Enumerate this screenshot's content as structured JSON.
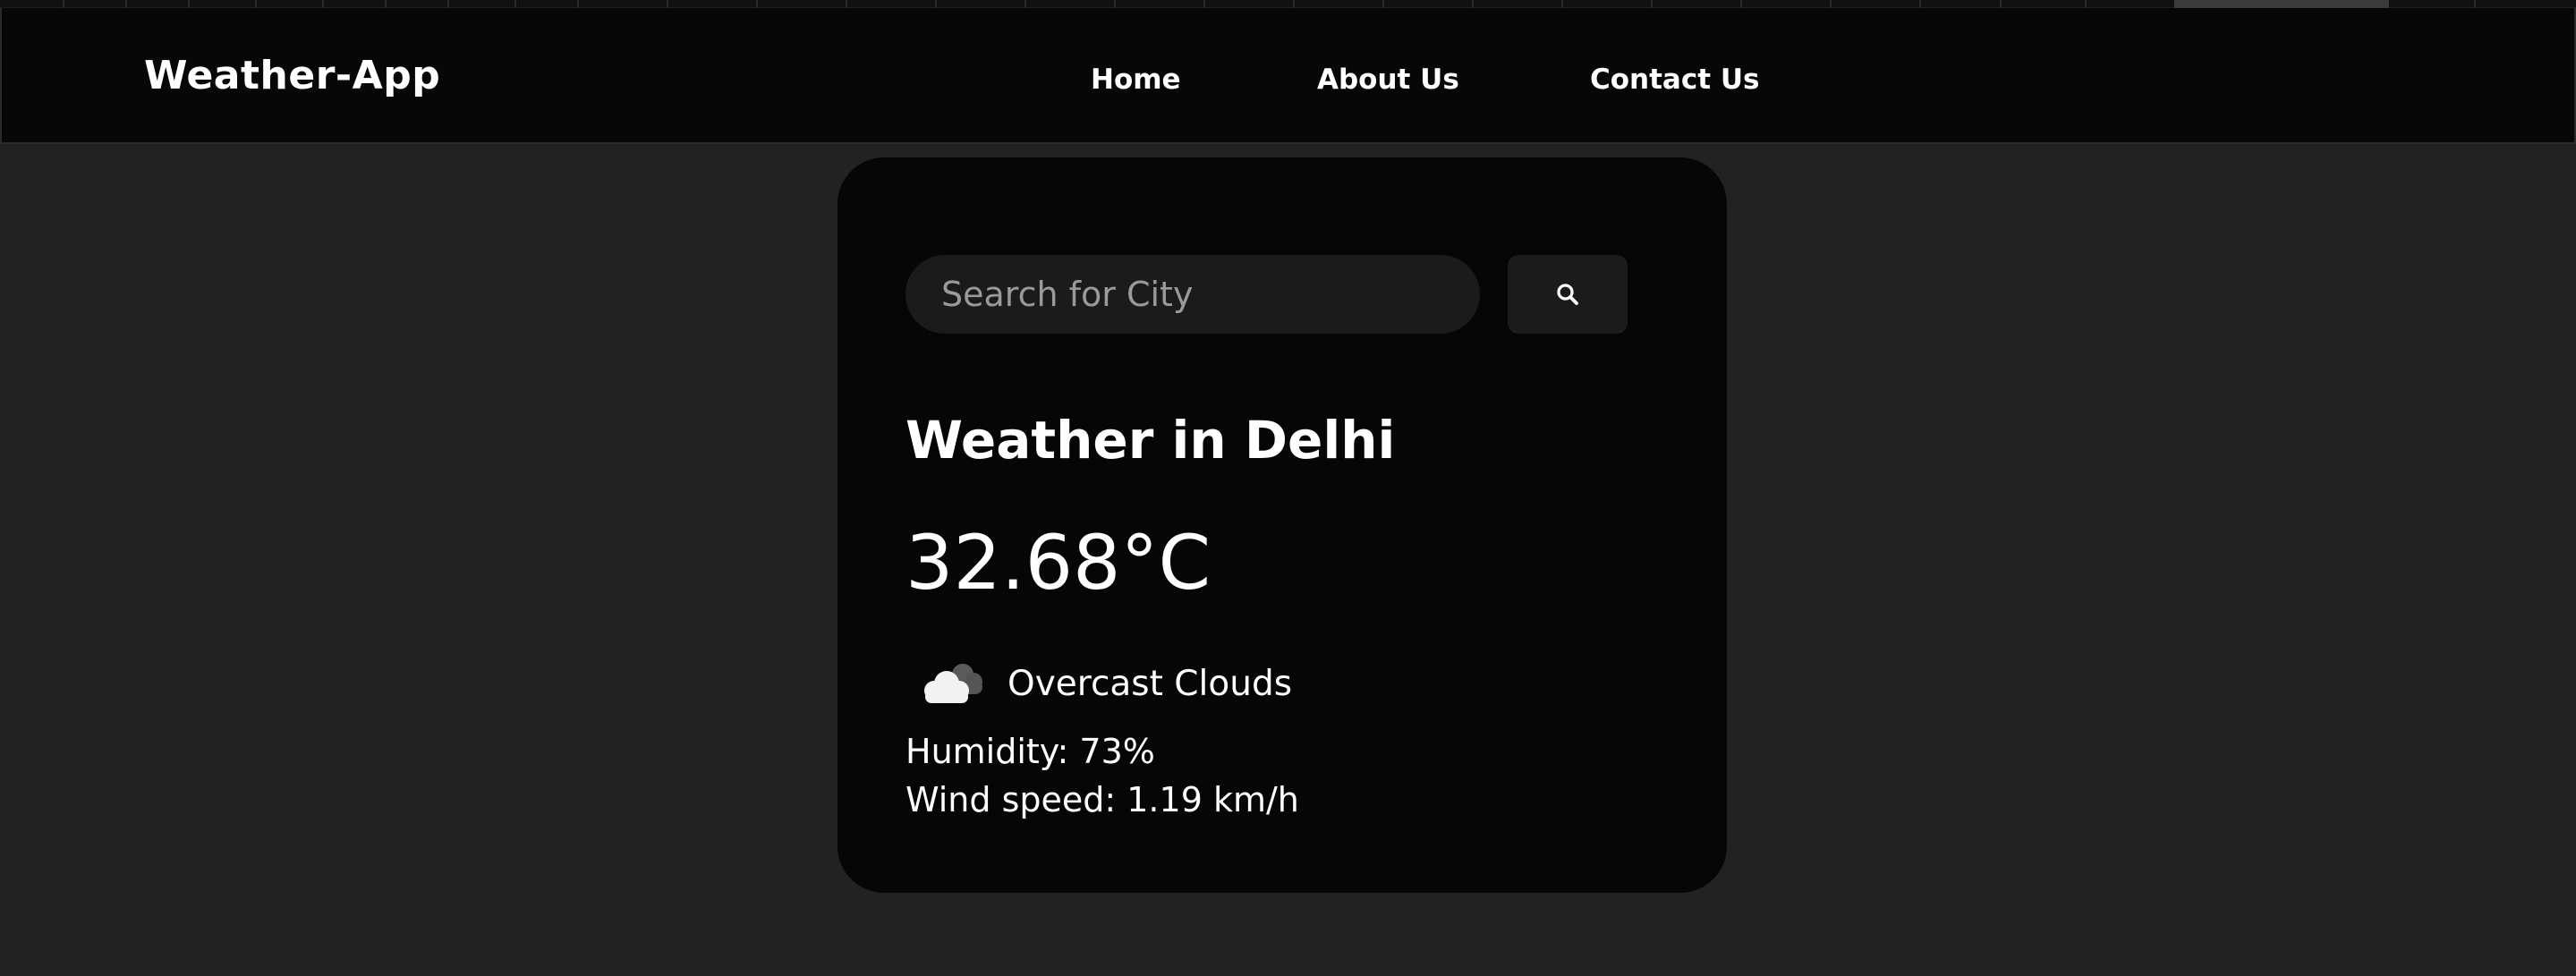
{
  "app": {
    "brand": "Weather-App"
  },
  "nav": {
    "home": "Home",
    "about": "About Us",
    "contact": "Contact Us"
  },
  "search": {
    "placeholder": "Search for City",
    "value": "",
    "button_icon": "search-icon"
  },
  "weather": {
    "title": "Weather in Delhi",
    "temperature": "32.68°C",
    "condition_icon": "cloud-icon",
    "condition": "Overcast Clouds",
    "humidity": "Humidity: 73%",
    "wind": "Wind speed: 1.19 km/h"
  },
  "colors": {
    "page_background": "#222222",
    "navbar_background": "#070707",
    "card_background": "#060606",
    "input_background": "#1b1b1b",
    "text": "#ffffff",
    "placeholder": "#9a9a9a"
  }
}
